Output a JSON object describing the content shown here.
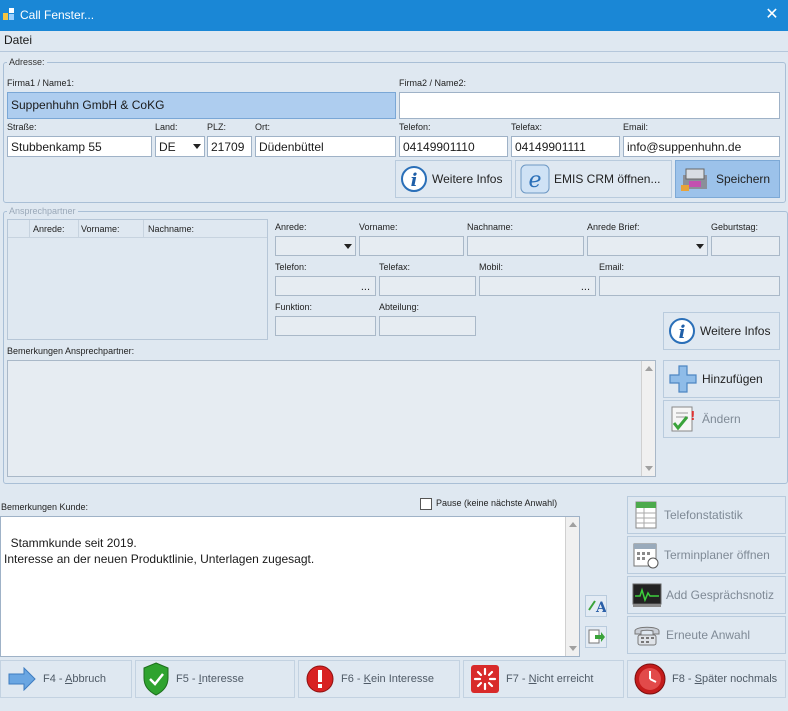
{
  "window": {
    "title": "Call Fenster...",
    "close_glyph": "✕"
  },
  "menu": {
    "datei": "Datei"
  },
  "adresse": {
    "group_title": "Adresse:",
    "firma1_label": "Firma1 / Name1:",
    "firma1_value": "Suppenhuhn GmbH & CoKG",
    "firma2_label": "Firma2 / Name2:",
    "firma2_value": "",
    "strasse_label": "Straße:",
    "strasse_value": "Stubbenkamp 55",
    "land_label": "Land:",
    "land_value": "DE",
    "plz_label": "PLZ:",
    "plz_value": "21709",
    "ort_label": "Ort:",
    "ort_value": "Düdenbüttel",
    "telefon_label": "Telefon:",
    "telefon_value": "04149901110",
    "telefax_label": "Telefax:",
    "telefax_value": "04149901111",
    "email_label": "Email:",
    "email_value": "info@suppenhuhn.de",
    "btn_weitere_infos": "Weitere Infos",
    "btn_emis_crm": "EMIS CRM öffnen...",
    "btn_speichern": "Speichern"
  },
  "ansprechpartner": {
    "group_title": "Ansprechpartner",
    "grid_columns": [
      "Anrede:",
      "Vorname:",
      "Nachname:"
    ],
    "anrede_label": "Anrede:",
    "vorname_label": "Vorname:",
    "nachname_label": "Nachname:",
    "anrede_brief_label": "Anrede Brief:",
    "geburtstag_label": "Geburtstag:",
    "telefon_label": "Telefon:",
    "telefax_label": "Telefax:",
    "mobil_label": "Mobil:",
    "email_label": "Email:",
    "funktion_label": "Funktion:",
    "abteilung_label": "Abteilung:",
    "dots": "...",
    "bemerkungen_label": "Bemerkungen Ansprechpartner:",
    "btn_weitere_infos": "Weitere Infos",
    "btn_hinzufuegen": "Hinzufügen",
    "btn_aendern": "Ändern"
  },
  "kunde": {
    "bemerkungen_label": "Bemerkungen Kunde:",
    "pause_label": "Pause (keine nächste Anwahl)",
    "bemerkungen_text": "Stammkunde seit 2019.\nInteresse an der neuen Produktlinie, Unterlagen zugesagt."
  },
  "side_buttons": {
    "telefonstatistik": "Telefonstatistik",
    "terminplaner": "Terminplaner öffnen",
    "gespraechsnotiz": "Add Gesprächsnotiz",
    "erneute_anwahl": "Erneute Anwahl"
  },
  "bottom_buttons": {
    "f4_prefix": "F4 - ",
    "f4_hot": "A",
    "f4_rest": "bbruch",
    "f5_prefix": "F5 - ",
    "f5_hot": "I",
    "f5_rest": "nteresse",
    "f6_prefix": "F6 - ",
    "f6_hot": "K",
    "f6_rest": "ein Interesse",
    "f7_prefix": "F7 - ",
    "f7_hot": "N",
    "f7_rest": "icht erreicht",
    "f8_prefix": "F8 - ",
    "f8_hot": "S",
    "f8_rest": "päter nochmals"
  },
  "colors": {
    "titlebar": "#1a87d6",
    "background": "#dfe8f1",
    "selected_field": "#aecdef",
    "save_button": "#9cc2ea"
  }
}
